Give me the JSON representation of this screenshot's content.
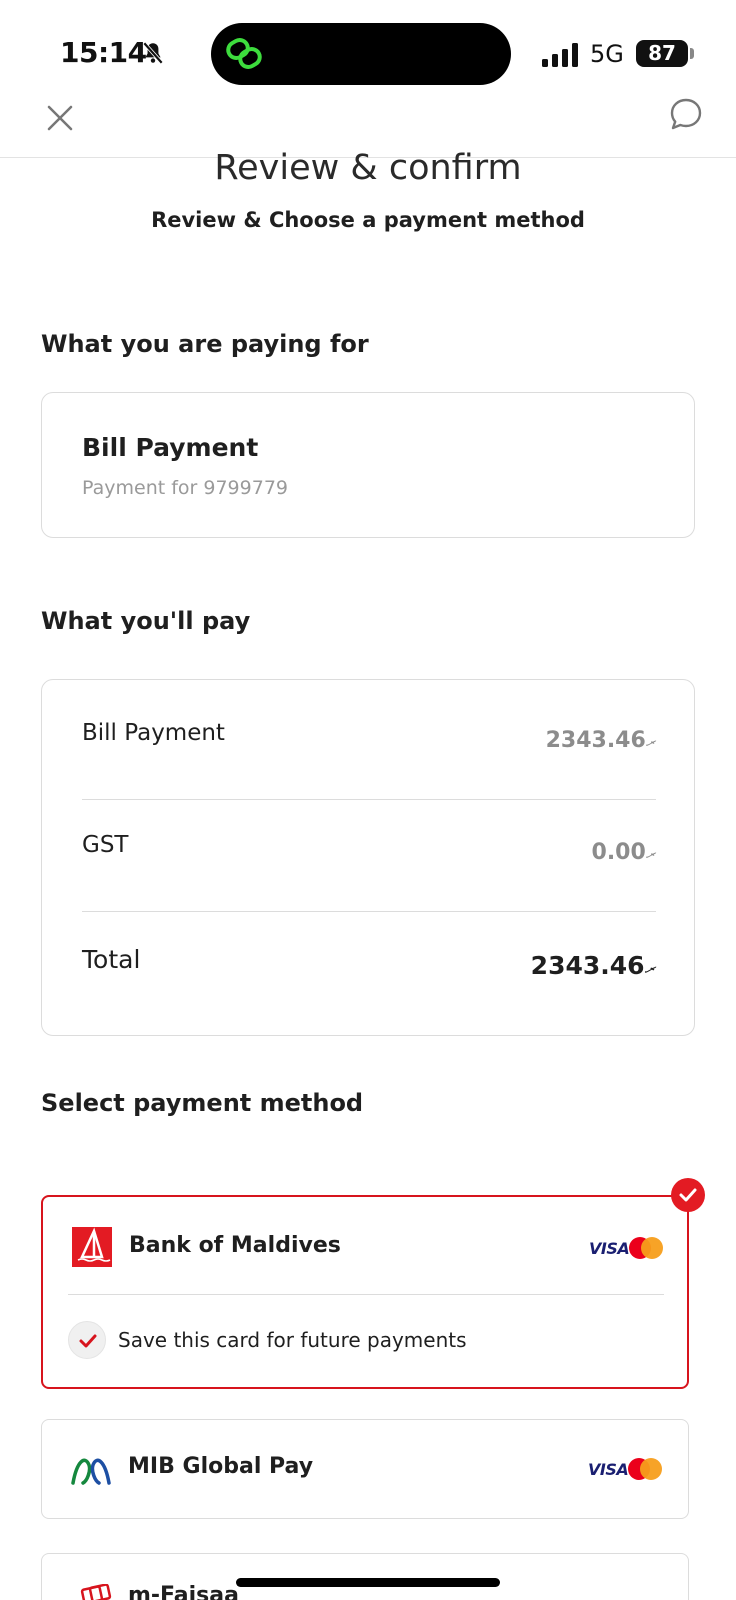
{
  "status_bar": {
    "time": "15:14",
    "network": "5G",
    "battery": "87"
  },
  "header": {
    "title": "Review & confirm",
    "subtitle": "Review & Choose a payment method"
  },
  "paying_for": {
    "heading": "What you are paying for",
    "item_title": "Bill Payment",
    "item_desc": "Payment for 9799779"
  },
  "pay_summary": {
    "heading": "What you'll pay",
    "currency_symbol": "ރ",
    "rows": [
      {
        "label": "Bill Payment",
        "value": "2343.46"
      },
      {
        "label": "GST",
        "value": "0.00"
      },
      {
        "label": "Total",
        "value": "2343.46"
      }
    ]
  },
  "payment_methods": {
    "heading": "Select payment method",
    "brand_visa": "VISA",
    "options": [
      {
        "name": "Bank of Maldives",
        "selected": true,
        "save_card_label": "Save this card for future payments"
      },
      {
        "name": "MIB Global Pay",
        "selected": false
      },
      {
        "name": "m-Faisaa",
        "selected": false
      }
    ]
  },
  "colors": {
    "accent": "#d7141d",
    "muted": "#9a9a9a",
    "border": "#dcdcdc"
  }
}
